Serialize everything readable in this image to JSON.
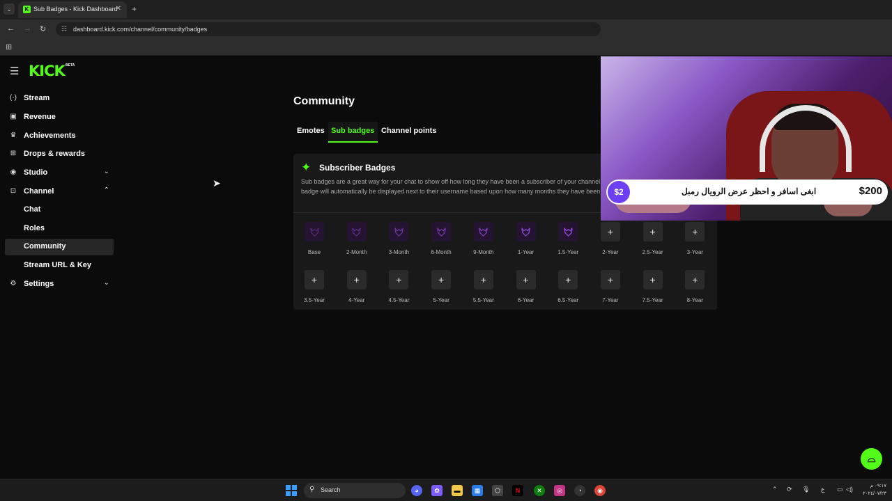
{
  "browser": {
    "tab_title": "Sub Badges - Kick Dashboard",
    "tab_favicon": "K",
    "url": "dashboard.kick.com/channel/community/badges"
  },
  "app": {
    "logo": "KICK",
    "logo_badge": "BETA",
    "accent_color": "#53fc18"
  },
  "sidebar": {
    "items": [
      {
        "label": "Stream",
        "icon": "broadcast-icon",
        "glyph": "(·)"
      },
      {
        "label": "Revenue",
        "icon": "dollar-icon",
        "glyph": "▣"
      },
      {
        "label": "Achievements",
        "icon": "trophy-icon",
        "glyph": "🏆"
      },
      {
        "label": "Drops & rewards",
        "icon": "gift-icon",
        "glyph": "⊞"
      },
      {
        "label": "Studio",
        "icon": "studio-icon",
        "glyph": "◉"
      },
      {
        "label": "Channel",
        "icon": "channel-icon",
        "glyph": "⊡"
      },
      {
        "label": "Chat"
      },
      {
        "label": "Roles"
      },
      {
        "label": "Community"
      },
      {
        "label": "Stream URL & Key"
      },
      {
        "label": "Settings",
        "icon": "gear-icon",
        "glyph": "⚙"
      }
    ]
  },
  "main": {
    "title": "Community",
    "tabs": [
      "Emotes",
      "Sub badges",
      "Channel points"
    ],
    "active_tab": "Sub badges",
    "card": {
      "title": "Subscriber Badges",
      "description": "Sub badges are a great way for your chat to show off how long they have been a subscriber of your channel. When someone subscribes, a badge will automatically be displayed next to their username based upon how many months they have been subscribed for."
    },
    "badges_row1": [
      "Base",
      "2-Month",
      "3-Month",
      "6-Month",
      "9-Month",
      "1-Year",
      "1.5-Year",
      "2-Year",
      "2.5-Year",
      "3-Year"
    ],
    "badges_row2": [
      "3.5-Year",
      "4-Year",
      "4.5-Year",
      "5-Year",
      "5.5-Year",
      "6-Year",
      "6.5-Year",
      "7-Year",
      "7.5-Year",
      "8-Year"
    ],
    "filled_badge_count": 7,
    "plus_glyph": "+"
  },
  "overlay": {
    "donation_amount_badge": "$2",
    "donation_message": "ابغى اسافر و احظر عرض الرويال رمبل",
    "donation_goal": "$200"
  },
  "taskbar": {
    "search_label": "Search",
    "clock_time": "٠٩:١٧ م",
    "clock_date": "٢٠٢٤/٠٧/٢٣",
    "lang": "ع"
  }
}
